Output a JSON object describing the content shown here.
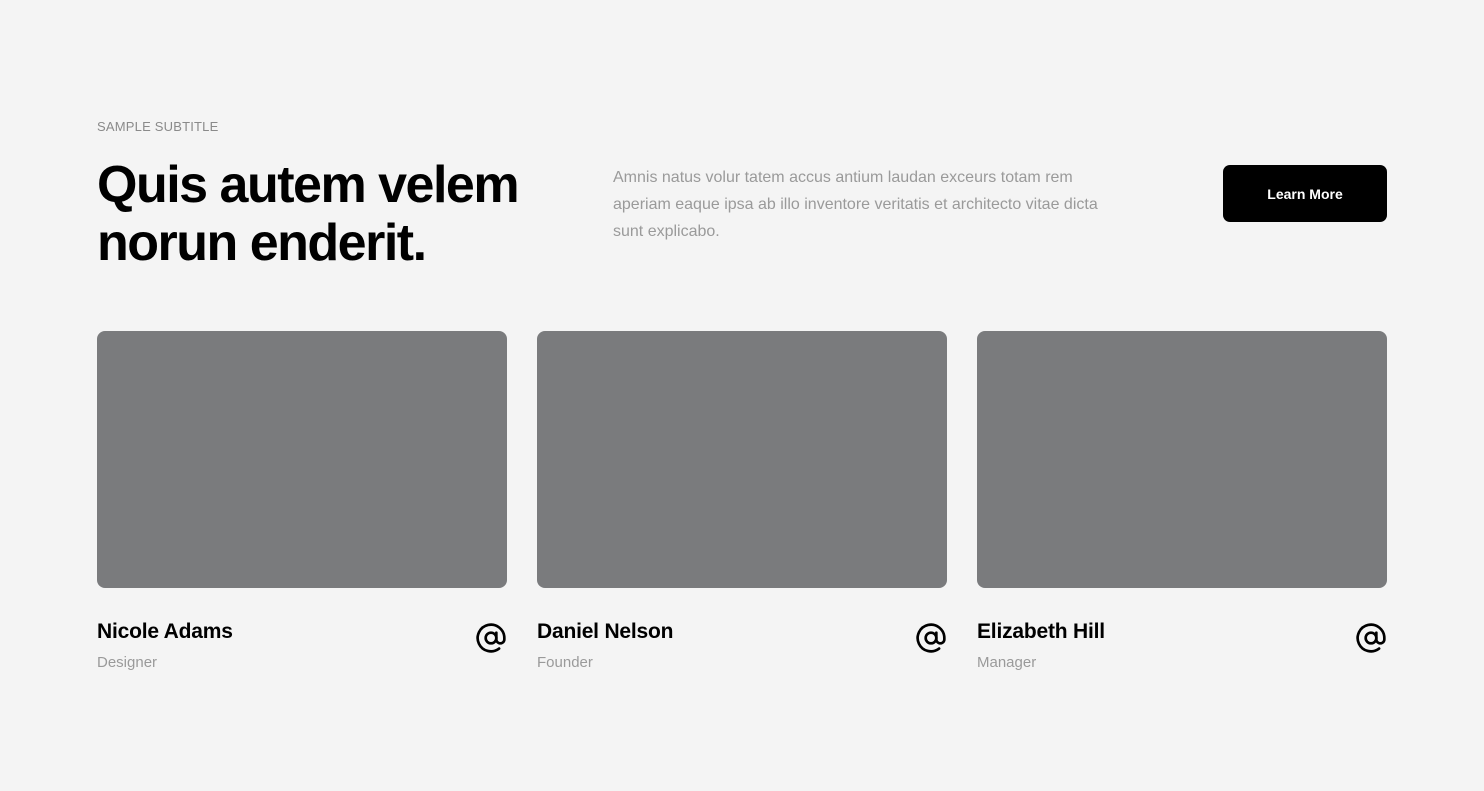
{
  "header": {
    "subtitle": "SAMPLE SUBTITLE",
    "title": "Quis autem velem norun enderit.",
    "description": "Amnis natus volur tatem accus antium laudan exceurs totam rem aperiam eaque ipsa ab illo inventore veritatis et architecto vitae dicta sunt explicabo.",
    "cta_label": "Learn More"
  },
  "team": [
    {
      "name": "Nicole Adams",
      "role": "Designer",
      "icon": "at-sign-icon"
    },
    {
      "name": "Daniel Nelson",
      "role": "Founder",
      "icon": "at-sign-icon"
    },
    {
      "name": "Elizabeth Hill",
      "role": "Manager",
      "icon": "at-sign-icon"
    }
  ],
  "colors": {
    "background": "#f4f4f4",
    "photo_placeholder": "#7a7b7d",
    "button": "#000000",
    "muted_text": "#9a9a9a"
  }
}
